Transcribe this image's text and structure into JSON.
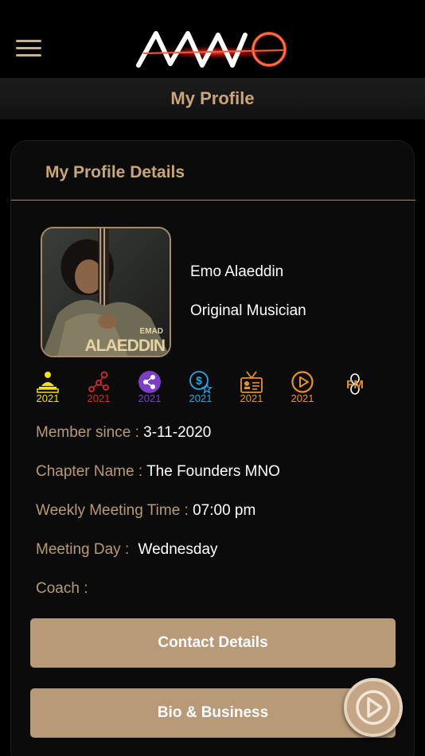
{
  "header": {
    "menu_icon": "hamburger-menu-icon",
    "logo_icon": "mno-logo"
  },
  "page": {
    "title": "My Profile"
  },
  "card": {
    "title": "My Profile Details"
  },
  "profile": {
    "avatar_text_small": "EMAD",
    "avatar_text_large": "ALAEDDIN",
    "name": "Emo Alaeddin",
    "role": "Original Musician"
  },
  "badges": [
    {
      "icon": "teacher-presentation-icon",
      "year": "2021",
      "color": "#f1e21a"
    },
    {
      "icon": "network-growth-icon",
      "year": "2021",
      "color": "#d32b2b"
    },
    {
      "icon": "share-circle-icon",
      "year": "2021",
      "color": "#7a3fc4"
    },
    {
      "icon": "dollar-star-icon",
      "year": "2021",
      "color": "#2aa7e8"
    },
    {
      "icon": "id-card-icon",
      "year": "2021",
      "color": "#e8902a"
    },
    {
      "icon": "play-circle-icon",
      "year": "2021",
      "color": "#e8902a"
    },
    {
      "icon": "fm-infinity-icon",
      "year": "FM",
      "color": "#e8902a"
    }
  ],
  "info": {
    "member_since_label": "Member since :",
    "member_since_value": "3-11-2020",
    "chapter_label": "Chapter Name :",
    "chapter_value": "The Founders MNO",
    "meeting_time_label": "Weekly Meeting Time :",
    "meeting_time_value": "07:00 pm",
    "meeting_day_label": "Meeting Day :",
    "meeting_day_value": "Wednesday",
    "coach_label": "Coach :",
    "coach_value": ""
  },
  "buttons": {
    "contact": "Contact Details",
    "bio": "Bio & Business"
  },
  "fab": {
    "icon": "play-circle-icon"
  }
}
